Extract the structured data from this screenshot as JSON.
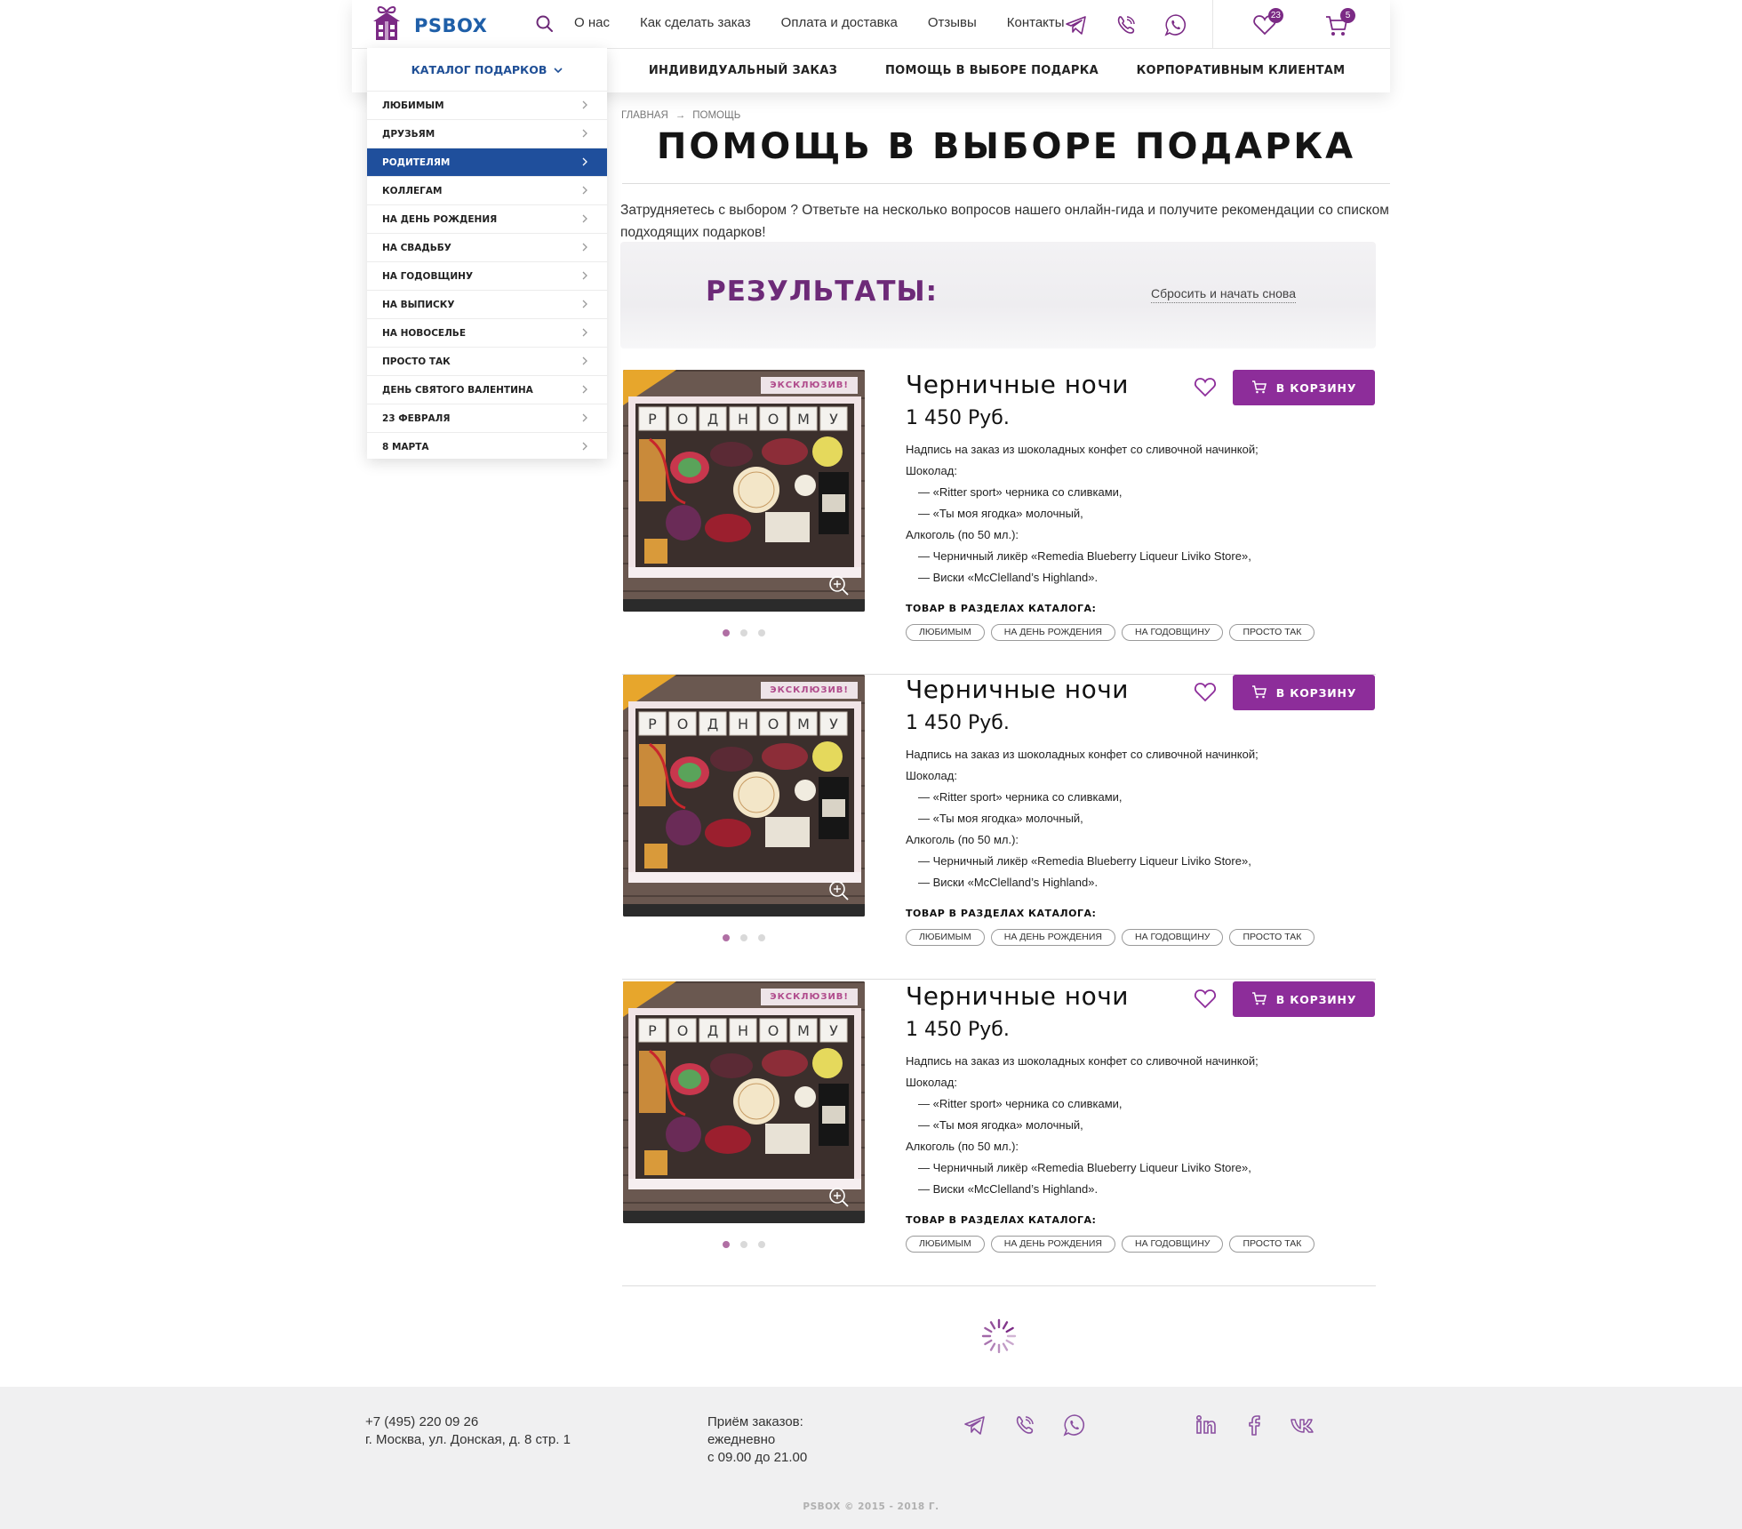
{
  "brand": {
    "name": "PSBOX",
    "accent": "#8d2d9a",
    "blue": "#1f4f9c"
  },
  "header": {
    "top_nav": [
      "О нас",
      "Как сделать заказ",
      "Оплата и доставка",
      "Отзывы",
      "Контакты"
    ],
    "messengers": [
      "telegram-icon",
      "viber-icon",
      "whatsapp-icon"
    ],
    "favorites_count": "23",
    "cart_count": "5",
    "sub_nav": [
      "ИНДИВИДУАЛЬНЫЙ ЗАКАЗ",
      "ПОМОЩЬ В ВЫБОРЕ ПОДАРКА",
      "КОРПОРАТИВНЫМ КЛИЕНТАМ"
    ]
  },
  "catalog": {
    "title": "КАТАЛОГ ПОДАРКОВ",
    "items": [
      "ЛЮБИМЫМ",
      "ДРУЗЬЯМ",
      "РОДИТЕЛЯМ",
      "КОЛЛЕГАМ",
      "НА ДЕНЬ РОЖДЕНИЯ",
      "НА СВАДЬБУ",
      "НА ГОДОВЩИНУ",
      "НА ВЫПИСКУ",
      "НА НОВОСЕЛЬЕ",
      "ПРОСТО ТАК",
      "ДЕНЬ СВЯТОГО ВАЛЕНТИНА",
      "23 ФЕВРАЛЯ",
      "8 МАРТА"
    ],
    "active_index": 2
  },
  "breadcrumb": {
    "home": "ГЛАВНАЯ",
    "arrow": "→",
    "current": "ПОМОЩЬ"
  },
  "page": {
    "title": "ПОМОЩЬ В ВЫБОРЕ ПОДАРКА",
    "intro": "Затрудняетесь с выбором ? Ответьте на несколько вопросов нашего онлайн-гида и получите рекомендации со списком подходящих подарков!"
  },
  "results": {
    "title": "РЕЗУЛЬТАТЫ:",
    "reset": "Сбросить и начать снова"
  },
  "product_common": {
    "badge": "ЭКСКЛЮЗИВ!",
    "cart_label": "В КОРЗИНУ",
    "catalog_label": "ТОВАР В РАЗДЕЛАХ КАТАЛОГА:",
    "photo_letters": [
      "Р",
      "О",
      "Д",
      "Н",
      "О",
      "М",
      "У"
    ]
  },
  "products": [
    {
      "name": "Черничные ночи",
      "price": "1 450 Руб.",
      "desc": [
        "Надпись на заказ из шоколадных конфет со сливочной начинкой;",
        "Шоколад:",
        "— «Ritter sport» черника со сливками,",
        "— «Ты моя ягодка» молочный,",
        "Алкоголь (по 50 мл.):",
        "— Черничный ликёр «Remedia Blueberry Liqueur Liviko Store»,",
        "— Виски «McClelland’s Highland»."
      ],
      "tags": [
        "ЛЮБИМЫМ",
        "НА ДЕНЬ РОЖДЕНИЯ",
        "НА ГОДОВЩИНУ",
        "ПРОСТО ТАК"
      ]
    },
    {
      "name": "Черничные ночи",
      "price": "1 450 Руб.",
      "desc": [
        "Надпись на заказ из шоколадных конфет со сливочной начинкой;",
        "Шоколад:",
        "— «Ritter sport» черника со сливками,",
        "— «Ты моя ягодка» молочный,",
        "Алкоголь (по 50 мл.):",
        "— Черничный ликёр «Remedia Blueberry Liqueur Liviko Store»,",
        "— Виски «McClelland’s Highland»."
      ],
      "tags": [
        "ЛЮБИМЫМ",
        "НА ДЕНЬ РОЖДЕНИЯ",
        "НА ГОДОВЩИНУ",
        "ПРОСТО ТАК"
      ]
    },
    {
      "name": "Черничные ночи",
      "price": "1 450 Руб.",
      "desc": [
        "Надпись на заказ из шоколадных конфет со сливочной начинкой;",
        "Шоколад:",
        "— «Ritter sport» черника со сливками,",
        "— «Ты моя ягодка» молочный,",
        "Алкоголь (по 50 мл.):",
        "— Черничный ликёр «Remedia Blueberry Liqueur Liviko Store»,",
        "— Виски «McClelland’s Highland»."
      ],
      "tags": [
        "ЛЮБИМЫМ",
        "НА ДЕНЬ РОЖДЕНИЯ",
        "НА ГОДОВЩИНУ",
        "ПРОСТО ТАК"
      ]
    }
  ],
  "footer": {
    "phone": "+7 (495) 220 09 26",
    "address": "г. Москва, ул. Донская, д. 8 стр. 1",
    "hours": [
      "Приём заказов:",
      "ежедневно",
      "с 09.00 до 21.00"
    ],
    "messengers": [
      "telegram-icon",
      "viber-icon",
      "whatsapp-icon"
    ],
    "socials": [
      "linkedin-icon",
      "facebook-icon",
      "vk-icon"
    ],
    "copyright": "PSBOX © 2015 - 2018 Г."
  }
}
